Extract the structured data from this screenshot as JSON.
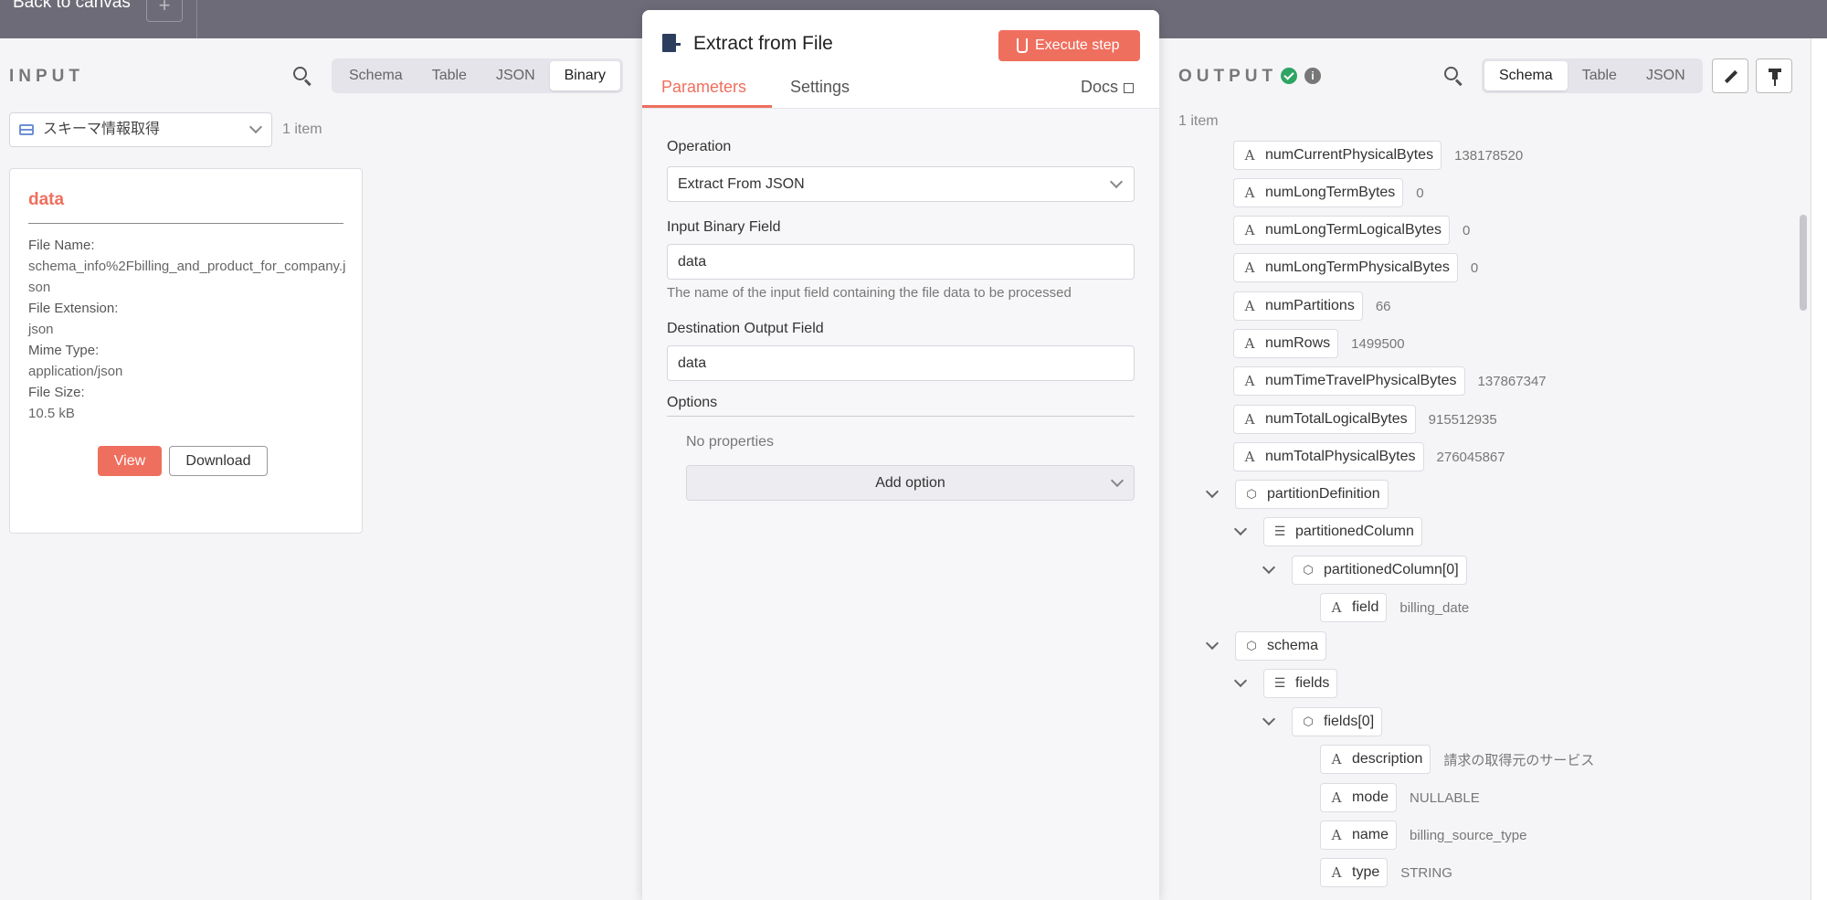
{
  "background": {
    "back_label": "Back to canvas",
    "add_symbol": "+"
  },
  "input": {
    "title": "INPUT",
    "tabs": [
      "Schema",
      "Table",
      "JSON",
      "Binary"
    ],
    "active_tab": "Binary",
    "node_select": "スキーマ情報取得",
    "items_count": "1 item",
    "card": {
      "title": "data",
      "file_name_label": "File Name:",
      "file_name": "schema_info%2Fbilling_and_product_for_company.json",
      "file_extension_label": "File Extension:",
      "file_extension": "json",
      "mime_type_label": "Mime Type:",
      "mime_type": "application/json",
      "file_size_label": "File Size:",
      "file_size": "10.5 kB",
      "view_label": "View",
      "download_label": "Download"
    }
  },
  "node": {
    "title": "Extract from File",
    "execute_label": "Execute step",
    "tabs": [
      "Parameters",
      "Settings"
    ],
    "active_tab": "Parameters",
    "docs_label": "Docs",
    "operation_label": "Operation",
    "operation_value": "Extract From JSON",
    "input_binary_label": "Input Binary Field",
    "input_binary_value": "data",
    "input_binary_hint": "The name of the input field containing the file data to be processed",
    "destination_label": "Destination Output Field",
    "destination_value": "data",
    "options_label": "Options",
    "no_properties": "No properties",
    "add_option_label": "Add option"
  },
  "output": {
    "title": "OUTPUT",
    "tabs": [
      "Schema",
      "Table",
      "JSON"
    ],
    "active_tab": "Schema",
    "items_count": "1 item",
    "status_color": "#2fa564",
    "accent_color": "#ef6f5e",
    "tree": [
      {
        "type": "string",
        "key": "numCurrentPhysicalBytes",
        "value": "138178520"
      },
      {
        "type": "string",
        "key": "numLongTermBytes",
        "value": "0"
      },
      {
        "type": "string",
        "key": "numLongTermLogicalBytes",
        "value": "0"
      },
      {
        "type": "string",
        "key": "numLongTermPhysicalBytes",
        "value": "0"
      },
      {
        "type": "string",
        "key": "numPartitions",
        "value": "66"
      },
      {
        "type": "string",
        "key": "numRows",
        "value": "1499500"
      },
      {
        "type": "string",
        "key": "numTimeTravelPhysicalBytes",
        "value": "137867347"
      },
      {
        "type": "string",
        "key": "numTotalLogicalBytes",
        "value": "915512935"
      },
      {
        "type": "string",
        "key": "numTotalPhysicalBytes",
        "value": "276045867"
      },
      {
        "type": "object",
        "key": "partitionDefinition",
        "value": ""
      },
      {
        "type": "array",
        "key": "partitionedColumn",
        "value": ""
      },
      {
        "type": "object",
        "key": "partitionedColumn[0]",
        "value": ""
      },
      {
        "type": "string",
        "key": "field",
        "value": "billing_date"
      },
      {
        "type": "object",
        "key": "schema",
        "value": ""
      },
      {
        "type": "array",
        "key": "fields",
        "value": ""
      },
      {
        "type": "object",
        "key": "fields[0]",
        "value": ""
      },
      {
        "type": "string",
        "key": "description",
        "value": "請求の取得元のサービス"
      },
      {
        "type": "string",
        "key": "mode",
        "value": "NULLABLE"
      },
      {
        "type": "string",
        "key": "name",
        "value": "billing_source_type"
      },
      {
        "type": "string",
        "key": "type",
        "value": "STRING"
      }
    ]
  }
}
